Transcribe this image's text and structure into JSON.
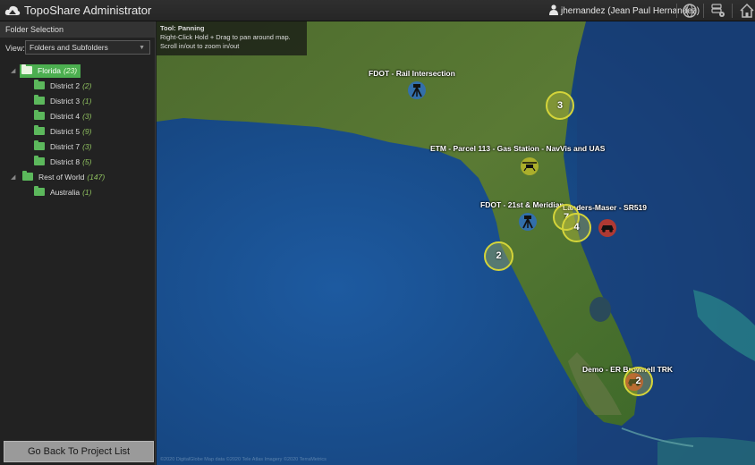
{
  "app": {
    "title": "TopoShare Administrator"
  },
  "header": {
    "user": "jhernandez (Jean Paul Hernandez)",
    "icons": [
      "user-icon",
      "globe-icon",
      "database-settings-icon",
      "home-icon"
    ]
  },
  "sidebar": {
    "header": "Folder Selection",
    "view_label": "View:",
    "view_value": "Folders and Subfolders",
    "tree": [
      {
        "label": "Florida",
        "count": "(23)",
        "selected": true
      },
      {
        "label": "District 2",
        "count": "(2)"
      },
      {
        "label": "District 3",
        "count": "(1)"
      },
      {
        "label": "District 4",
        "count": "(3)"
      },
      {
        "label": "District 5",
        "count": "(9)"
      },
      {
        "label": "District 7",
        "count": "(3)"
      },
      {
        "label": "District 8",
        "count": "(5)"
      },
      {
        "label": "Rest of World",
        "count": "(147)"
      },
      {
        "label": "Australia",
        "count": "(1)"
      }
    ],
    "back_button": "Go Back To Project List"
  },
  "map": {
    "tool_title": "Tool: Panning",
    "tool_line1": "Right-Click Hold + Drag to pan around map.",
    "tool_line2": "Scroll in/out to zoom in/out",
    "pins": [
      "FDOT - Rail Intersection",
      "ETM - Parcel 113 - Gas Station - NavVis and UAS",
      "FDOT - 21st & Meridian",
      "Landers-Maser - SR519",
      "Demo - ER Brownell TRK"
    ],
    "clusters": [
      "3",
      "7",
      "4",
      "2",
      "2"
    ],
    "copyright": "©2020 DigitalGlobe  Map data ©2020 Tele Atlas  Imagery ©2020 TerraMetrics"
  },
  "colors": {
    "accent": "#4caf50",
    "cluster": "#d4d43a",
    "water": "#1a4a85"
  }
}
